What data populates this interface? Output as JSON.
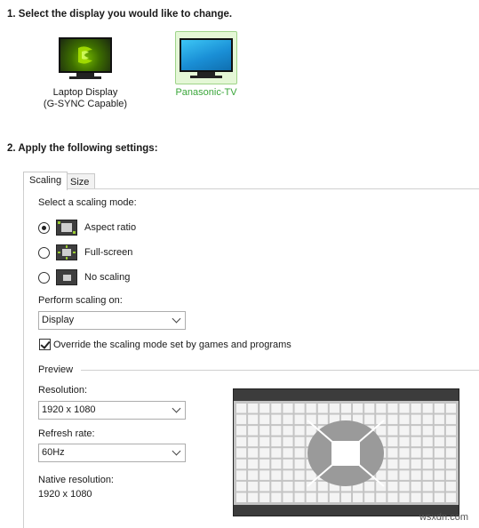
{
  "step1": {
    "title": "1. Select the display you would like to change."
  },
  "displays": [
    {
      "label": "Laptop Display\n(G-SYNC Capable)",
      "selected": false
    },
    {
      "label": "Panasonic-TV",
      "selected": true
    }
  ],
  "step2": {
    "title": "2. Apply the following settings:"
  },
  "tabs": [
    {
      "label": "Scaling",
      "active": true
    },
    {
      "label": "Size",
      "active": false
    }
  ],
  "scaling": {
    "mode_heading": "Select a scaling mode:",
    "modes": [
      {
        "label": "Aspect ratio",
        "checked": true,
        "icon": "aspect-ratio-icon"
      },
      {
        "label": "Full-screen",
        "checked": false,
        "icon": "full-screen-icon"
      },
      {
        "label": "No scaling",
        "checked": false,
        "icon": "no-scaling-icon"
      }
    ],
    "perform_on_label": "Perform scaling on:",
    "perform_on_value": "Display",
    "override_label": "Override the scaling mode set by games and programs",
    "override_checked": true
  },
  "preview": {
    "heading": "Preview",
    "resolution_label": "Resolution:",
    "resolution_value": "1920 x 1080",
    "refresh_label": "Refresh rate:",
    "refresh_value": "60Hz",
    "native_label": "Native resolution:",
    "native_value": "1920 x 1080"
  },
  "watermark": "wsxdn.com",
  "colors": {
    "selected_text": "#3aa63a",
    "selected_bg": "#e4f7d6",
    "nvidia_green": "#76b900"
  }
}
